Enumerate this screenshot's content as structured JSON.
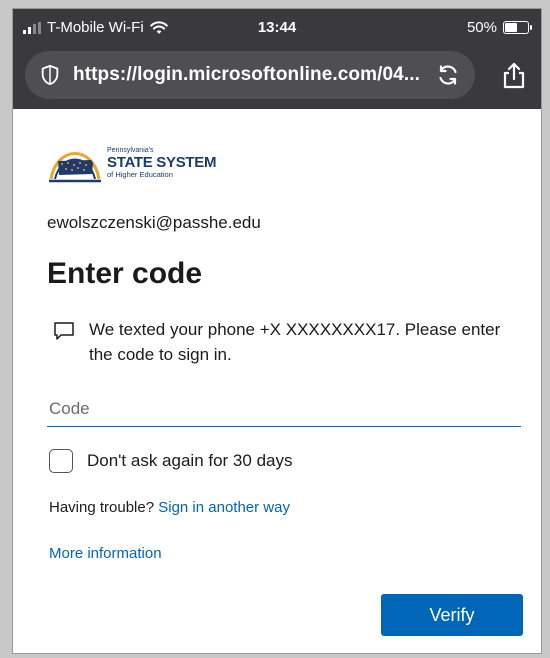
{
  "status_bar": {
    "carrier": "T-Mobile Wi-Fi",
    "time": "13:44",
    "battery": "50%",
    "battery_level": 0.5
  },
  "browser": {
    "url": "https://login.microsoftonline.com/04...",
    "icons": [
      "shield-icon",
      "reload-icon",
      "share-icon"
    ]
  },
  "logo": {
    "line1": "Pennsylvania's",
    "line2": "STATE SYSTEM",
    "line3": "of Higher Education"
  },
  "form": {
    "email": "ewolszczenski@passhe.edu",
    "heading": "Enter code",
    "message": "We texted your phone +X XXXXXXXX17. Please enter the code to sign in.",
    "code_placeholder": "Code",
    "code_value": "",
    "remember_label": "Don't ask again for 30 days",
    "trouble_text": "Having trouble?",
    "sign_in_another_way": "Sign in another way",
    "more_information": "More information",
    "verify_label": "Verify"
  },
  "colors": {
    "accent": "#0067b8",
    "chrome": "#3a3a3c",
    "urlbar": "#4f4f52",
    "logo_navy": "#1f3b6e",
    "logo_gold": "#e8a830"
  }
}
